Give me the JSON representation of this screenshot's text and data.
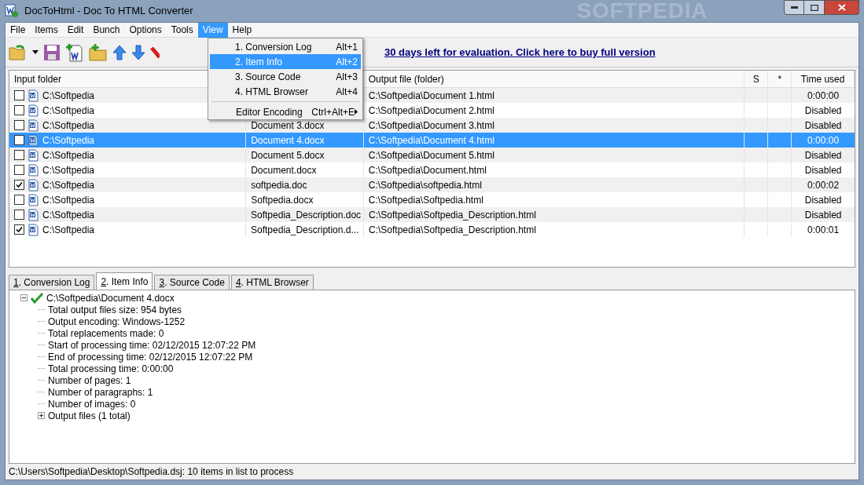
{
  "window": {
    "title": "DocToHtml - Doc To HTML Converter",
    "watermark": "SOFTPEDIA"
  },
  "menu_bar": [
    {
      "label": "File",
      "selected": false
    },
    {
      "label": "Items",
      "selected": false
    },
    {
      "label": "Edit",
      "selected": false
    },
    {
      "label": "Bunch",
      "selected": false
    },
    {
      "label": "Options",
      "selected": false
    },
    {
      "label": "Tools",
      "selected": false
    },
    {
      "label": "View",
      "selected": true
    },
    {
      "label": "Help",
      "selected": false
    }
  ],
  "view_menu": [
    {
      "label": "1. Conversion Log",
      "shortcut": "Alt+1",
      "selected": false,
      "kind": "item"
    },
    {
      "label": "2. Item Info",
      "shortcut": "Alt+2",
      "selected": true,
      "kind": "item"
    },
    {
      "label": "3. Source Code",
      "shortcut": "Alt+3",
      "selected": false,
      "kind": "item"
    },
    {
      "label": "4. HTML Browser",
      "shortcut": "Alt+4",
      "selected": false,
      "kind": "item"
    },
    {
      "kind": "separator"
    },
    {
      "label": "Editor Encoding",
      "shortcut": "Ctrl+Alt+E",
      "selected": false,
      "kind": "submenu"
    }
  ],
  "toolbar": {
    "evaluation_link": "30 days left for evaluation. Click here to buy full version"
  },
  "table": {
    "columns": [
      "Input folder",
      "Output file (folder)",
      "S",
      "*",
      "Time used"
    ],
    "rows": [
      {
        "checked": false,
        "selected": false,
        "input_folder": "C:\\Softpedia",
        "output_file": "C:\\Softpedia\\Document 1.html",
        "time_used": "0:00:00"
      },
      {
        "checked": false,
        "selected": false,
        "input_folder": "C:\\Softpedia",
        "output_file": "C:\\Softpedia\\Document 2.html",
        "time_used": "Disabled"
      },
      {
        "checked": false,
        "selected": false,
        "input_folder": "C:\\Softpedia",
        "input_file": "Document 3.docx",
        "output_file": "C:\\Softpedia\\Document 3.html",
        "time_used": "Disabled"
      },
      {
        "checked": false,
        "selected": true,
        "input_folder": "C:\\Softpedia",
        "input_file": "Document 4.docx",
        "output_file": "C:\\Softpedia\\Document 4.html",
        "time_used": "0:00:00"
      },
      {
        "checked": false,
        "selected": false,
        "input_folder": "C:\\Softpedia",
        "input_file": "Document 5.docx",
        "output_file": "C:\\Softpedia\\Document 5.html",
        "time_used": "Disabled"
      },
      {
        "checked": false,
        "selected": false,
        "input_folder": "C:\\Softpedia",
        "input_file": "Document.docx",
        "output_file": "C:\\Softpedia\\Document.html",
        "time_used": "Disabled"
      },
      {
        "checked": true,
        "selected": false,
        "input_folder": "C:\\Softpedia",
        "input_file": "softpedia.doc",
        "output_file": "C:\\Softpedia\\softpedia.html",
        "time_used": "0:00:02"
      },
      {
        "checked": false,
        "selected": false,
        "input_folder": "C:\\Softpedia",
        "input_file": "Softpedia.docx",
        "output_file": "C:\\Softpedia\\Softpedia.html",
        "time_used": "Disabled"
      },
      {
        "checked": false,
        "selected": false,
        "input_folder": "C:\\Softpedia",
        "input_file": "Softpedia_Description.doc",
        "output_file": "C:\\Softpedia\\Softpedia_Description.html",
        "time_used": "Disabled"
      },
      {
        "checked": true,
        "selected": false,
        "input_folder": "C:\\Softpedia",
        "input_file": "Softpedia_Description.d...",
        "output_file": "C:\\Softpedia\\Softpedia_Description.html",
        "time_used": "0:00:01"
      }
    ]
  },
  "tabs": [
    {
      "number": "1",
      "label": ". Conversion Log",
      "selected": false
    },
    {
      "number": "2",
      "label": ". Item Info",
      "selected": true
    },
    {
      "number": "3",
      "label": ". Source Code",
      "selected": false
    },
    {
      "number": "4",
      "label": ". HTML Browser",
      "selected": false
    }
  ],
  "item_info": {
    "label": "C:\\Softpedia\\Document 4.docx",
    "expanded": true,
    "children": [
      {
        "label": "Total output files size: 954 bytes"
      },
      {
        "label": "Output encoding: Windows-1252"
      },
      {
        "label": "Total replacements made: 0"
      },
      {
        "label": "Start of processing time: 02/12/2015 12:07:22 PM"
      },
      {
        "label": "End of processing time: 02/12/2015 12:07:22 PM"
      },
      {
        "label": "Total processing time: 0:00:00"
      },
      {
        "label": "Number of pages: 1"
      },
      {
        "label": "Number of paragraphs: 1"
      },
      {
        "label": "Number of images: 0"
      },
      {
        "label": "Output files (1 total)",
        "expanded": false
      }
    ]
  },
  "status_bar": "C:\\Users\\Softpedia\\Desktop\\Softpedia.dsj: 10 items in list to process"
}
